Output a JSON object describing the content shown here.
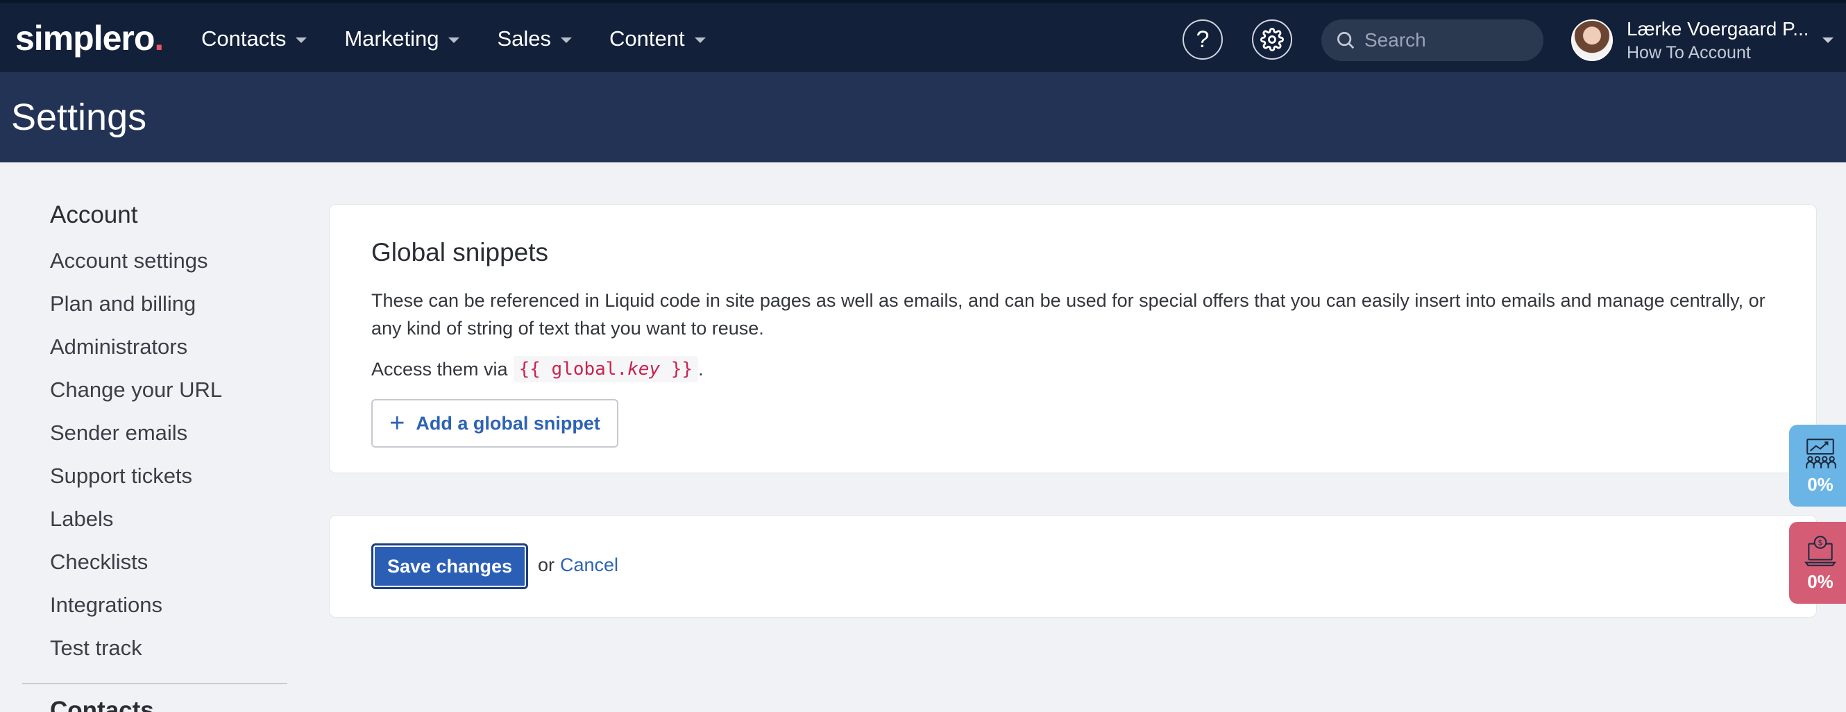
{
  "brand": {
    "logo_text": "simplero",
    "logo_dot": "."
  },
  "nav": {
    "items": [
      {
        "label": "Contacts"
      },
      {
        "label": "Marketing"
      },
      {
        "label": "Sales"
      },
      {
        "label": "Content"
      }
    ],
    "help_label": "?",
    "search_placeholder": "Search"
  },
  "user": {
    "name": "Lærke Voergaard P...",
    "account": "How To Account"
  },
  "page": {
    "title": "Settings"
  },
  "sidebar": {
    "heading": "Account",
    "items": [
      {
        "label": "Account settings"
      },
      {
        "label": "Plan and billing"
      },
      {
        "label": "Administrators"
      },
      {
        "label": "Change your URL"
      },
      {
        "label": "Sender emails"
      },
      {
        "label": "Support tickets"
      },
      {
        "label": "Labels"
      },
      {
        "label": "Checklists"
      },
      {
        "label": "Integrations"
      },
      {
        "label": "Test track"
      }
    ],
    "next_heading": "Contacts"
  },
  "snippets": {
    "title": "Global snippets",
    "description": "These can be referenced in Liquid code in site pages as well as emails, and can be used for special offers that you can easily insert into emails and manage centrally, or any kind of string of text that you want to reuse.",
    "access_prefix": "Access them via",
    "code_open": "{{ global.",
    "code_key": "key",
    "code_close": " }}",
    "access_suffix": ".",
    "add_label": "Add a global snippet"
  },
  "actions": {
    "save_label": "Save changes",
    "or_text": "or",
    "cancel_label": "Cancel"
  },
  "widgets": [
    {
      "value": "0%",
      "color": "#6bb5e6"
    },
    {
      "value": "0%",
      "color": "#d45d75"
    }
  ]
}
